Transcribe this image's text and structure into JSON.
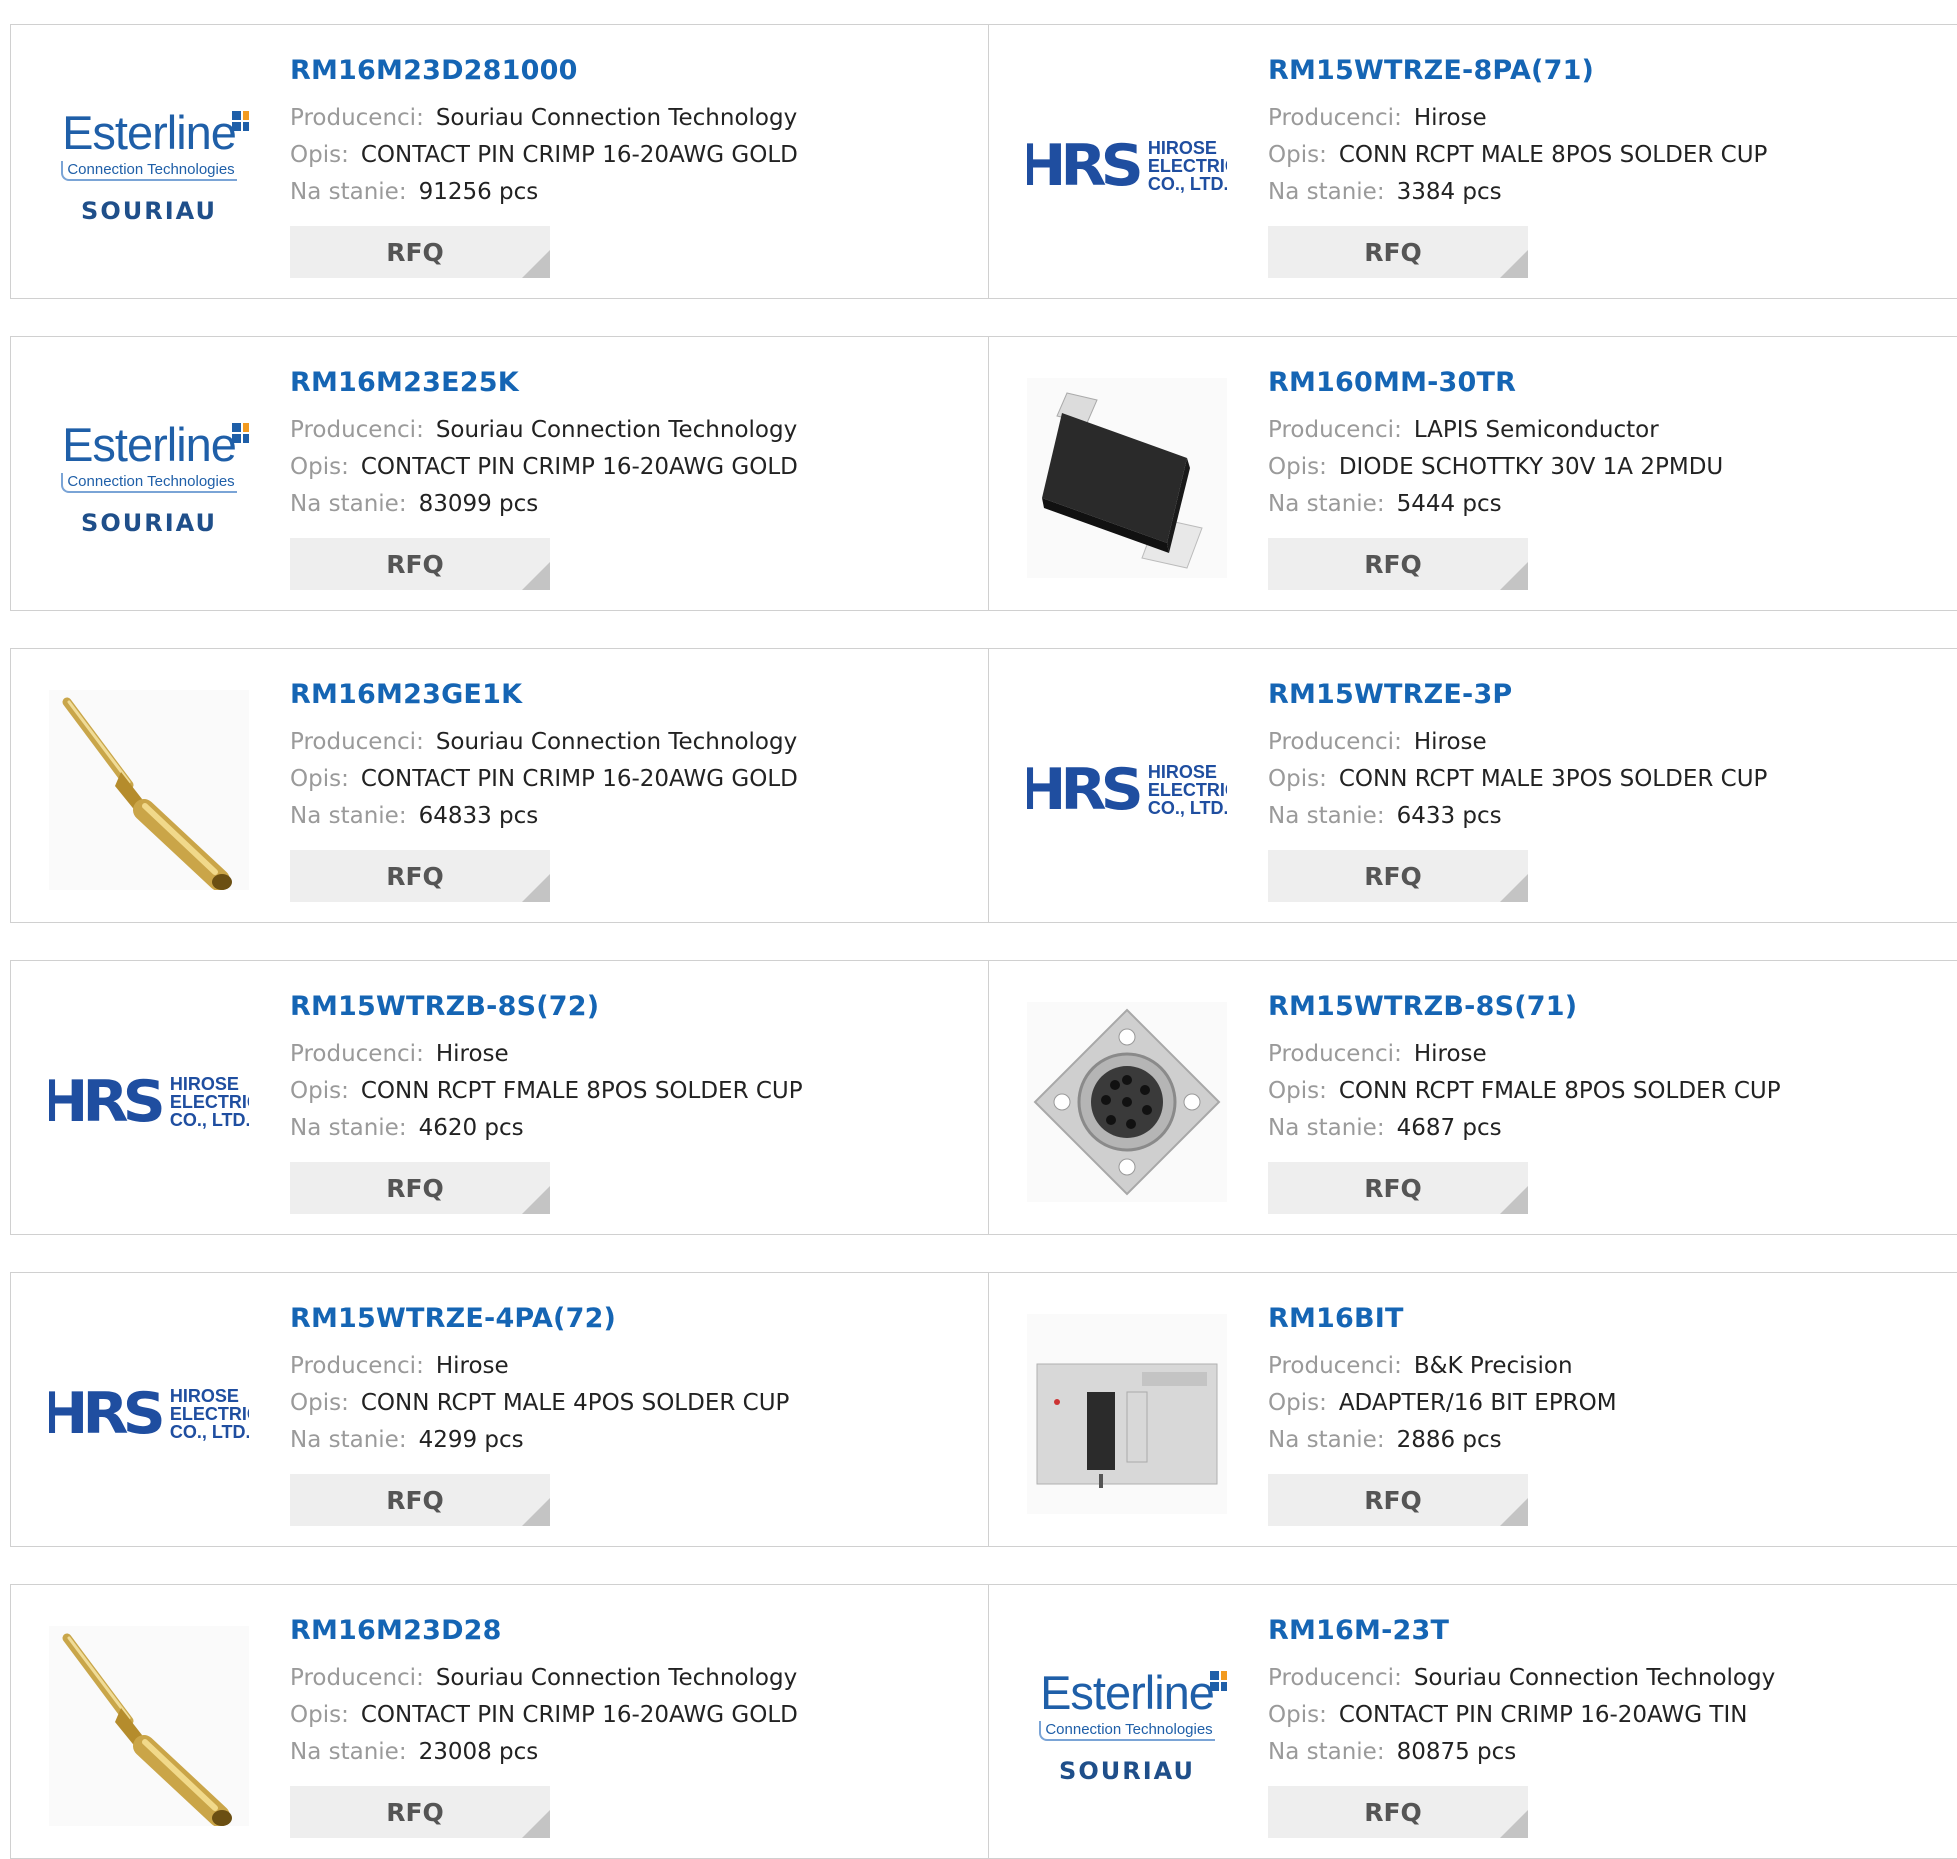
{
  "labels": {
    "manufacturer": "Producenci:",
    "description": "Opis:",
    "stock": "Na stanie:",
    "rfq": "RFQ"
  },
  "logos": {
    "esterline": {
      "word": "Esterline",
      "sub": "Connection Technologies",
      "brand": "SOURIAU"
    },
    "hrs": {
      "mark": "HRS",
      "line1": "HIROSE",
      "line2": "ELECTRIC",
      "line3": "CO., LTD."
    }
  },
  "products": [
    {
      "part": "RM16M23D281000",
      "manufacturer": "Souriau Connection Technology",
      "description": "CONTACT PIN CRIMP 16-20AWG GOLD",
      "stock": "91256 pcs",
      "image": "esterline-logo"
    },
    {
      "part": "RM15WTRZE-8PA(71)",
      "manufacturer": "Hirose",
      "description": "CONN RCPT MALE 8POS SOLDER CUP",
      "stock": "3384 pcs",
      "image": "hrs-logo"
    },
    {
      "part": "RM16M23E25K",
      "manufacturer": "Souriau Connection Technology",
      "description": "CONTACT PIN CRIMP 16-20AWG GOLD",
      "stock": "83099 pcs",
      "image": "esterline-logo"
    },
    {
      "part": "RM160MM-30TR",
      "manufacturer": "LAPIS Semiconductor",
      "description": "DIODE SCHOTTKY 30V 1A 2PMDU",
      "stock": "5444 pcs",
      "image": "diode-photo"
    },
    {
      "part": "RM16M23GE1K",
      "manufacturer": "Souriau Connection Technology",
      "description": "CONTACT PIN CRIMP 16-20AWG GOLD",
      "stock": "64833 pcs",
      "image": "crimp-pin-photo"
    },
    {
      "part": "RM15WTRZE-3P",
      "manufacturer": "Hirose",
      "description": "CONN RCPT MALE 3POS SOLDER CUP",
      "stock": "6433 pcs",
      "image": "hrs-logo"
    },
    {
      "part": "RM15WTRZB-8S(72)",
      "manufacturer": "Hirose",
      "description": "CONN RCPT FMALE 8POS SOLDER CUP",
      "stock": "4620 pcs",
      "image": "hrs-logo"
    },
    {
      "part": "RM15WTRZB-8S(71)",
      "manufacturer": "Hirose",
      "description": "CONN RCPT FMALE 8POS SOLDER CUP",
      "stock": "4687 pcs",
      "image": "circular-connector-photo"
    },
    {
      "part": "RM15WTRZE-4PA(72)",
      "manufacturer": "Hirose",
      "description": "CONN RCPT MALE 4POS SOLDER CUP",
      "stock": "4299 pcs",
      "image": "hrs-logo"
    },
    {
      "part": "RM16BIT",
      "manufacturer": "B&K Precision",
      "description": "ADAPTER/16 BIT EPROM",
      "stock": "2886 pcs",
      "image": "eprom-adapter-photo"
    },
    {
      "part": "RM16M23D28",
      "manufacturer": "Souriau Connection Technology",
      "description": "CONTACT PIN CRIMP 16-20AWG GOLD",
      "stock": "23008 pcs",
      "image": "crimp-pin-photo"
    },
    {
      "part": "RM16M-23T",
      "manufacturer": "Souriau Connection Technology",
      "description": "CONTACT PIN CRIMP 16-20AWG TIN",
      "stock": "80875 pcs",
      "image": "esterline-logo"
    }
  ],
  "colors": {
    "link": "#1565b4",
    "label": "#9a9a9a",
    "border": "#d0d0d0",
    "rfq_bg": "#eeeeee",
    "logo_blue": "#1f4ea0"
  }
}
